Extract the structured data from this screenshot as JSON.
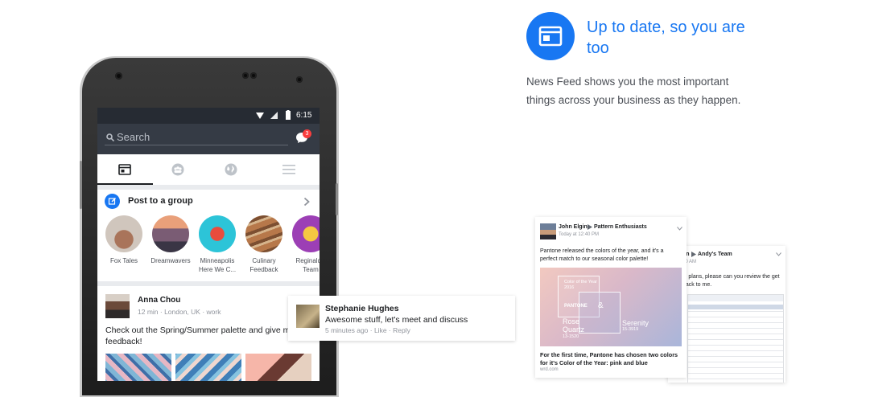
{
  "phone": {
    "status": {
      "time": "6:15"
    },
    "search": {
      "placeholder": "Search"
    },
    "notification_badge": "3",
    "post_to_group": {
      "label": "Post to a group"
    },
    "groups": [
      {
        "name": "Fox Tales"
      },
      {
        "name": "Dreamwavers"
      },
      {
        "name": "Minneapolis Here We C..."
      },
      {
        "name": "Culinary Feedback"
      },
      {
        "name": "Reginald's Team"
      }
    ],
    "post": {
      "author": "Anna Chou",
      "meta": "12 min · London, UK · work",
      "text": "Check out the Spring/Summer palette and give me your feedback!"
    }
  },
  "comment": {
    "author": "Stephanie Hughes",
    "text": "Awesome stuff, let's meet and discuss",
    "meta": "5 minutes ago · Like · Reply"
  },
  "feature": {
    "title": "Up to date, so you are too",
    "description": "News Feed shows you the most important things across your business as they happen."
  },
  "card1": {
    "author": "John Elgin",
    "group": "Pattern Enthusiasts",
    "time": "Today at 12:40 PM",
    "text": "Pantone released the colors of the year, and it's a perfect match to our seasonal color palette!",
    "image": {
      "label_top": "Color of the Year 2016",
      "pantone": "PANTONE",
      "amp": "&",
      "color1_name": "Rose Quartz",
      "color1_code": "13-1520",
      "color2_name": "Serenity",
      "color2_code": "15-3919"
    },
    "link_title": "For the first time, Pantone has chosen two colors for it's Color of the Year: pink and blue",
    "link_domain": "wrd.com"
  },
  "card2": {
    "author_partial": "on",
    "group": "Andy's Team",
    "time": "10 AM",
    "text": "al plans, please can you review the get back to me."
  }
}
